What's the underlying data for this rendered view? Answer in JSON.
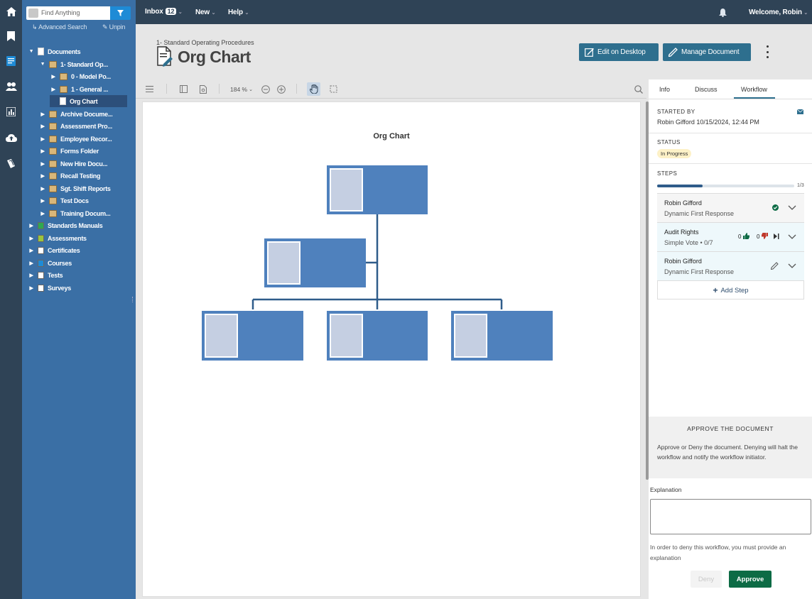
{
  "topbar": {
    "inbox_label": "Inbox",
    "inbox_count": "12",
    "new_label": "New",
    "help_label": "Help",
    "welcome": "Welcome, Robin"
  },
  "search": {
    "placeholder": "Find Anything",
    "advanced": "Advanced Search",
    "unpin": "Unpin"
  },
  "tree": {
    "root": "Documents",
    "sop": "1- Standard Op...",
    "model": "0 - Model Po...",
    "general": "1 - General ...",
    "orgchart": "Org Chart",
    "folders": [
      "Archive Docume...",
      "Assessment Pro...",
      "Employee Recor...",
      "Forms Folder",
      "New Hire Docu...",
      "Recall Testing",
      "Sgt. Shift Reports",
      "Test Docs",
      "Training Docum..."
    ],
    "modules": [
      "Standards Manuals",
      "Assessments",
      "Certificates",
      "Courses",
      "Tests",
      "Surveys"
    ]
  },
  "header": {
    "breadcrumb": "1- Standard Operating Procedures",
    "title": "Org Chart",
    "edit_label": "Edit on Desktop",
    "manage_label": "Manage Document"
  },
  "viewer": {
    "zoom": "184 %",
    "page_title": "Org Chart"
  },
  "tabs": [
    "Info",
    "Discuss",
    "Workflow"
  ],
  "workflow": {
    "started_by_label": "STARTED BY",
    "started_by": "Robin Gifford 10/15/2024, 12:44 PM",
    "status_label": "STATUS",
    "status": "In Progress",
    "steps_label": "STEPS",
    "progress_text": "1/3",
    "progress": 0.33,
    "steps": [
      {
        "name": "Robin Gifford",
        "sub": "Dynamic First Response"
      },
      {
        "name": "Audit Rights",
        "sub": "Simple Vote • 0/7",
        "up": "0",
        "down": "0"
      },
      {
        "name": "Robin Gifford",
        "sub": "Dynamic First Response"
      }
    ],
    "add_step": "Add Step"
  },
  "approve": {
    "title": "APPROVE THE DOCUMENT",
    "desc": "Approve or Deny the document. Denying will halt the workflow and notify the workflow initiator.",
    "explanation_label": "Explanation",
    "hint": "In order to deny this workflow, you must provide an explanation",
    "deny": "Deny",
    "approve": "Approve"
  },
  "colors": {
    "nav": "#3a6fa5",
    "topbar": "#2f4356",
    "accent": "#2e6f8e",
    "approve": "#0d6b45",
    "box": "#4f81bd"
  }
}
